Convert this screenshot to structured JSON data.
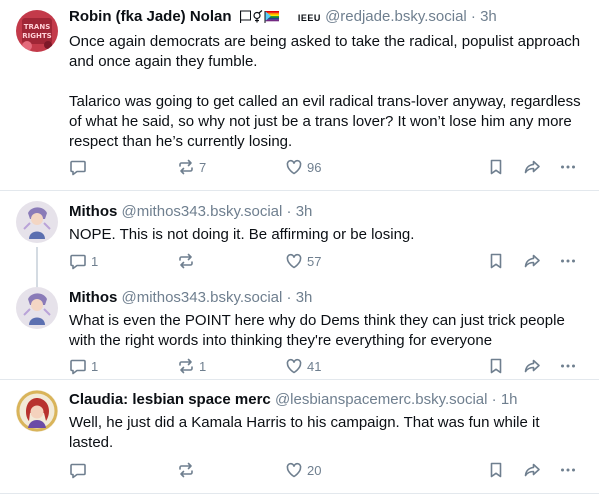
{
  "posts": [
    {
      "author": "Robin (fka Jade) Nolan",
      "badges": "IEEU",
      "handle": "@redjade.bsky.social",
      "time": "3h",
      "paragraphs": [
        "Once again democrats are being asked to take the radical, populist approach and once again they fumble.",
        "Talarico was going to get called an evil radical trans-lover anyway, regardless of what he said, so why not just be a trans lover? It won’t lose him any more respect than he’s currently losing."
      ],
      "replies": "",
      "reposts": "7",
      "likes": "96"
    },
    {
      "author": "Mithos",
      "handle": "@mithos343.bsky.social",
      "time": "3h",
      "paragraphs": [
        "NOPE. This is not doing it. Be affirming or be losing."
      ],
      "replies": "1",
      "reposts": "",
      "likes": "57"
    },
    {
      "author": "Mithos",
      "handle": "@mithos343.bsky.social",
      "time": "3h",
      "paragraphs": [
        "What is even the POINT here why do Dems think they can just trick people with the right words into thinking they're everything for everyone"
      ],
      "replies": "1",
      "reposts": "1",
      "likes": "41"
    },
    {
      "author": "Claudia: lesbian space merc",
      "handle": "@lesbianspacemerc.bsky.social",
      "time": "1h",
      "paragraphs": [
        "Well, he just did a Kamala Harris to his campaign. That was fun while it lasted."
      ],
      "replies": "",
      "reposts": "",
      "likes": "20"
    }
  ],
  "separator": "·",
  "icons": [
    "reply-icon",
    "repost-icon",
    "like-icon",
    "bookmark-icon",
    "share-icon",
    "more-icon"
  ],
  "colors": {
    "muted": "#6f7f8f",
    "text": "#0b0f14",
    "thread_line": "#d4dbe2",
    "divider": "#e3e8ed"
  }
}
